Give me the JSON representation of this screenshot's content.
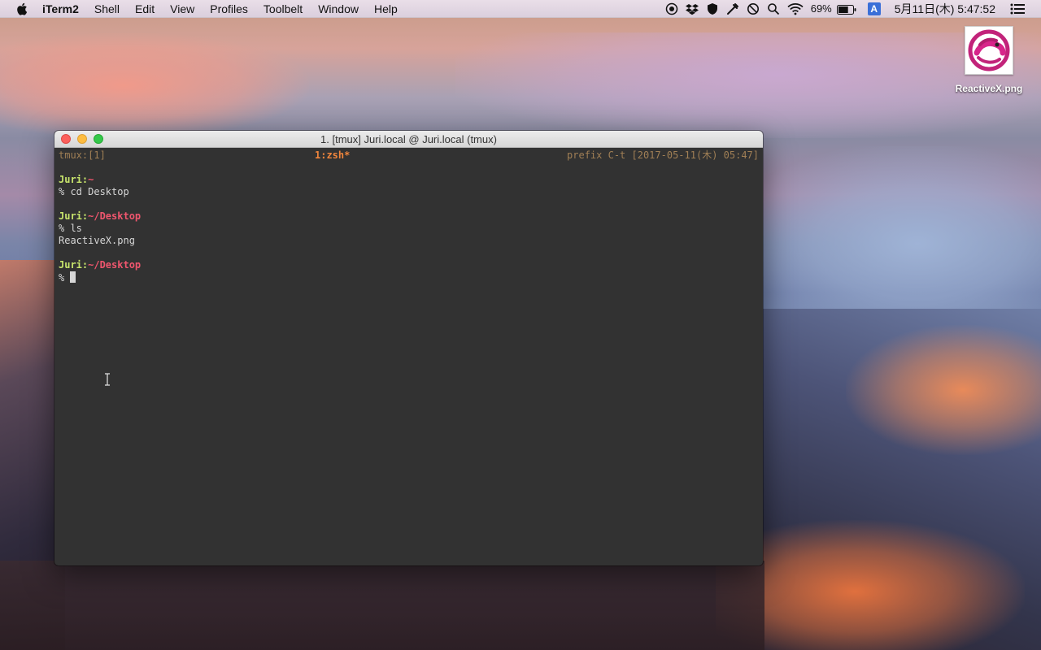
{
  "menubar": {
    "apple_icon": "apple-icon",
    "app_name": "iTerm2",
    "items": [
      "Shell",
      "Edit",
      "View",
      "Profiles",
      "Toolbelt",
      "Window",
      "Help"
    ],
    "status": {
      "icons": [
        "record-icon",
        "dropbox-icon",
        "shield-icon",
        "tools-icon",
        "do-not-disturb-icon",
        "search-icon",
        "wifi-icon"
      ],
      "battery_percent": "69%",
      "battery_level": 0.69,
      "input_source": "A",
      "clock": "5月11日(木)  5:47:52"
    }
  },
  "desktop": {
    "file_label": "ReactiveX.png",
    "file_icon": "reactivex-logo-icon"
  },
  "window": {
    "title": "1. [tmux] Juri.local @ Juri.local (tmux)",
    "tmux": {
      "left": "tmux:[1]",
      "center": "1:zsh*",
      "right": "prefix C-t [2017-05-11(木) 05:47]"
    },
    "prompt_user": "Juri:",
    "lines": [
      {
        "path": "~",
        "command": "% cd Desktop"
      },
      {
        "path": "~/Desktop",
        "command": "% ls",
        "output": "ReactiveX.png"
      },
      {
        "path": "~/Desktop",
        "command": "%"
      }
    ]
  },
  "colors": {
    "terminal_bg": "#323232",
    "user_green": "#c8e56c",
    "path_red": "#f0566e",
    "tmux_orange": "#f0853c",
    "tmux_tan": "#a07f55"
  }
}
